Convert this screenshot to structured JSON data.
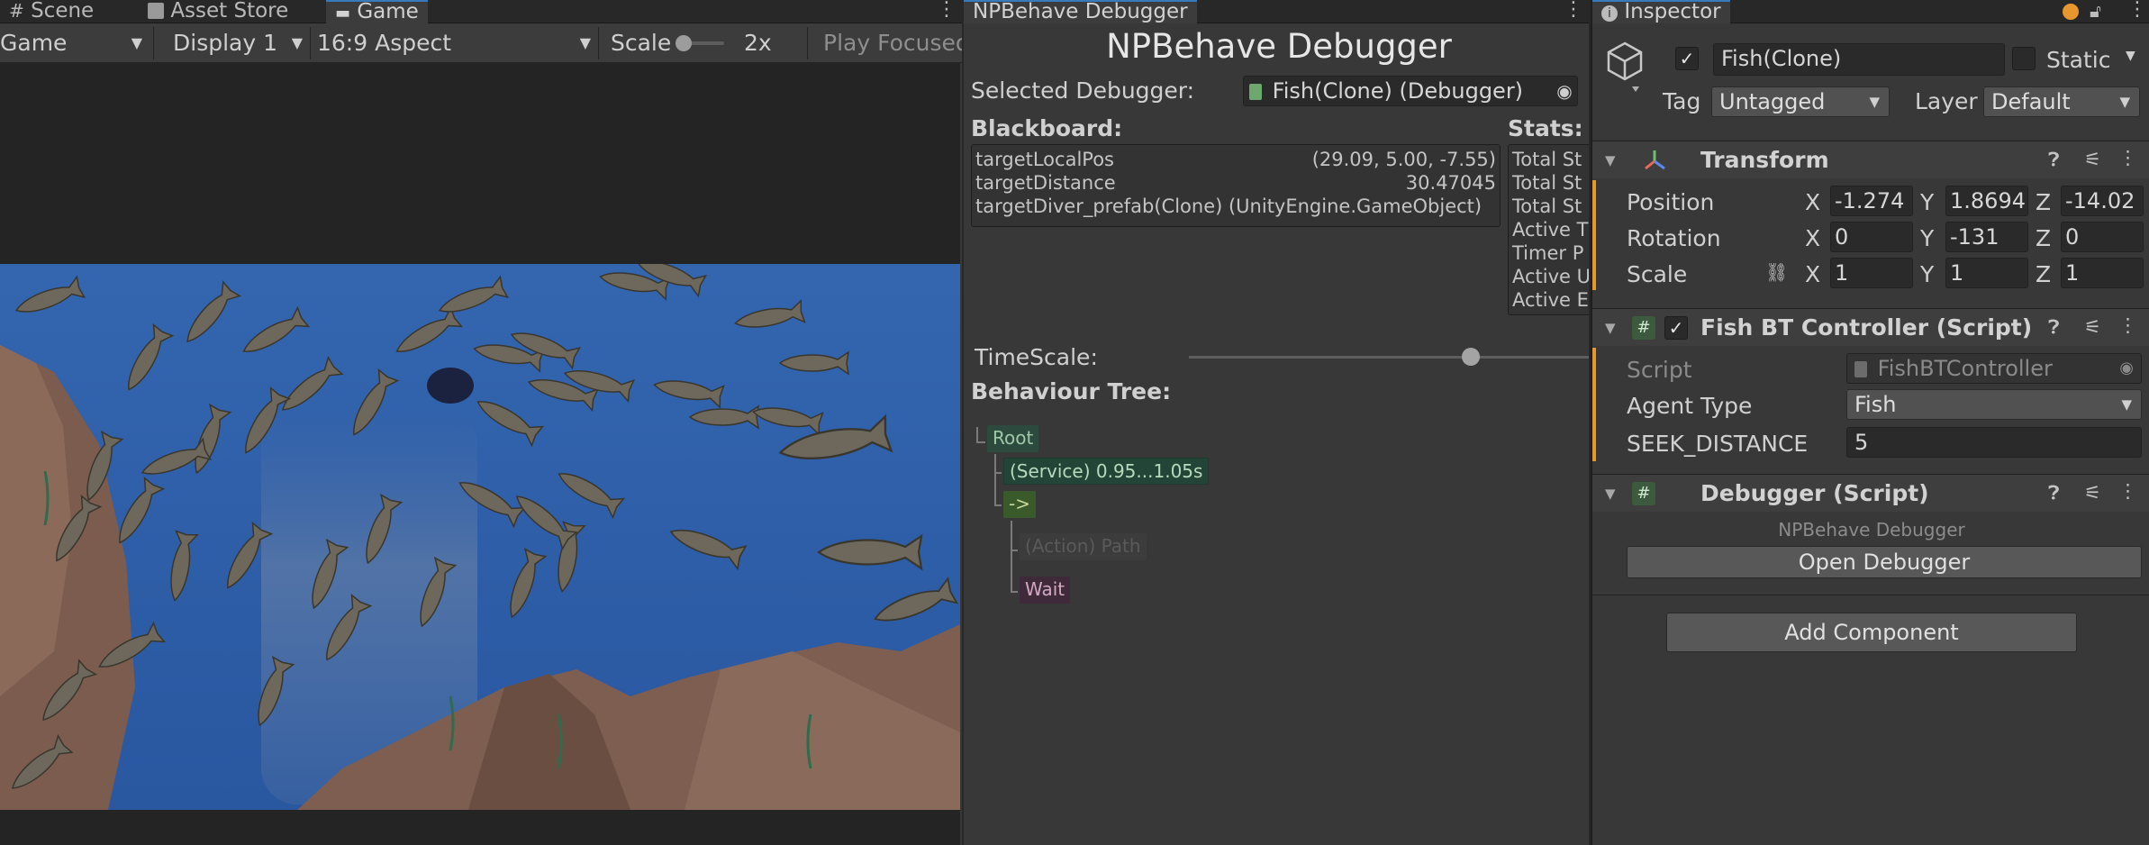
{
  "game_panel": {
    "tabs": [
      "Scene",
      "Asset Store",
      "Game"
    ],
    "active_tab": "Game",
    "toolbar": {
      "mode": "Game",
      "display": "Display 1",
      "aspect": "16:9 Aspect",
      "scale_label": "Scale",
      "scale_value": "2x",
      "scale_level": 0.0,
      "play_mode": "Play Focused"
    }
  },
  "debugger_panel": {
    "tab": "NPBehave Debugger",
    "title": "NPBehave Debugger",
    "selected_label": "Selected Debugger:",
    "selected_value": "Fish(Clone) (Debugger)",
    "blackboard_label": "Blackboard:",
    "blackboard": [
      {
        "key": "targetLocalPos",
        "value": "(29.09, 5.00, -7.55)"
      },
      {
        "key": "targetDistance",
        "value": "30.47045"
      },
      {
        "key": "targetDiver_prefab(Clone) (UnityEngine.GameObject)",
        "value": ""
      }
    ],
    "stats_label": "Stats:",
    "stats": [
      "Total St",
      "Total St",
      "Total St",
      "Active T",
      "Timer P",
      "Active U",
      "Active E"
    ],
    "timescale_label": "TimeScale:",
    "timescale_level": 0.68,
    "tree_label": "Behaviour Tree:",
    "tree": {
      "root": "Root",
      "service": "(Service) 0.95...1.05s",
      "sequence": "->",
      "action": "(Action) Path",
      "wait": "Wait"
    }
  },
  "inspector": {
    "tab": "Inspector",
    "object_name": "Fish(Clone)",
    "static_label": "Static",
    "tag_label": "Tag",
    "tag_value": "Untagged",
    "layer_label": "Layer",
    "layer_value": "Default",
    "transform": {
      "title": "Transform",
      "rows": [
        {
          "label": "Position",
          "x": "-1.274",
          "y": "1.8694",
          "z": "-14.02"
        },
        {
          "label": "Rotation",
          "x": "0",
          "y": "-131",
          "z": "0"
        },
        {
          "label": "Scale",
          "x": "1",
          "y": "1",
          "z": "1"
        }
      ],
      "axis_x": "X",
      "axis_y": "Y",
      "axis_z": "Z"
    },
    "fish_controller": {
      "title": "Fish BT Controller (Script)",
      "script_label": "Script",
      "script_value": "FishBTController",
      "agent_label": "Agent Type",
      "agent_value": "Fish",
      "seek_label": "SEEK_DISTANCE",
      "seek_value": "5"
    },
    "debugger_script": {
      "title": "Debugger (Script)",
      "caption": "NPBehave Debugger",
      "button": "Open Debugger"
    },
    "add_component": "Add Component"
  },
  "colors": {
    "accent_orange": "#e8962e",
    "ocean": "#2d5ca4",
    "rock": "#7b5c4e"
  }
}
